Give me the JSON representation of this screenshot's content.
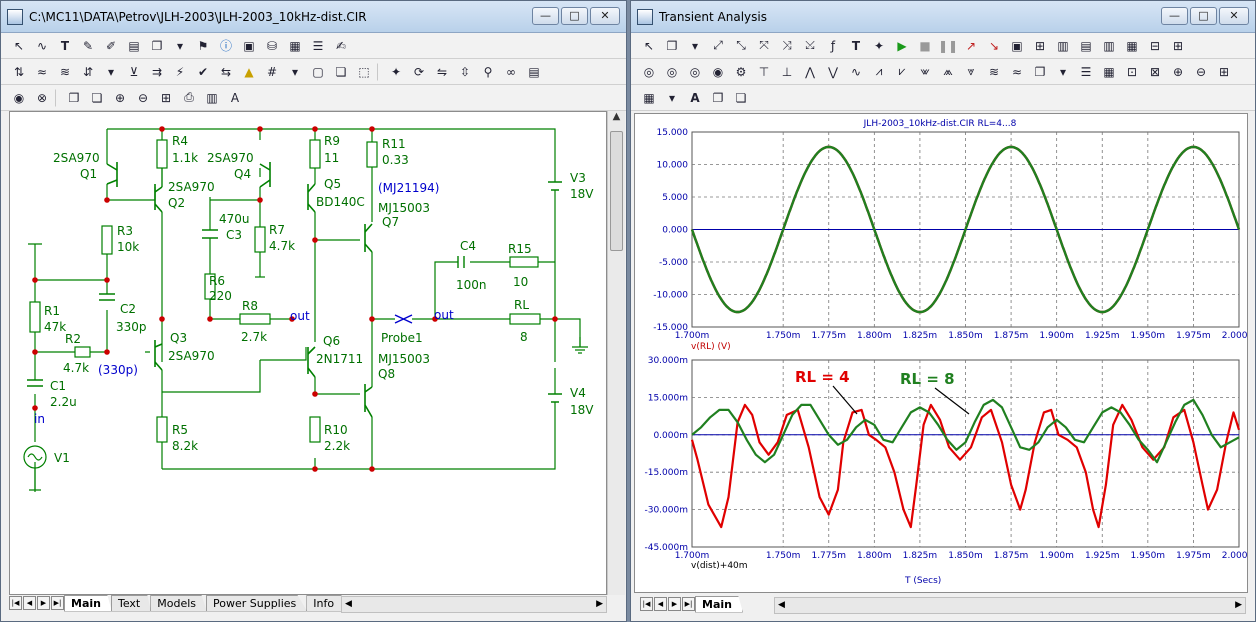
{
  "left_window": {
    "title": "C:\\MC11\\DATA\\Petrov\\JLH-2003\\JLH-2003_10kHz-dist.CIR",
    "controls": [
      "—",
      "□",
      "✕"
    ],
    "tabs": [
      "Main",
      "Text",
      "Models",
      "Power Supplies",
      "Info"
    ],
    "active_tab": "Main"
  },
  "schematic": {
    "labels": {
      "q1_type": "2SA970",
      "q1": "Q1",
      "q2_type": "2SA970",
      "q2": "Q2",
      "r4": "R4",
      "r4v": "1.1k",
      "q4_type": "2SA970",
      "q4": "Q4",
      "r9": "R9",
      "r9v": "11",
      "r11": "R11",
      "r11v": "0.33",
      "q5": "Q5",
      "q5_type": "BD140C",
      "mj21194": "(MJ21194)",
      "mj15003a": "MJ15003",
      "q7": "Q7",
      "v3": "V3",
      "v3v": "18V",
      "r3": "R3",
      "r3v": "10k",
      "c3v": "470u",
      "c3": "C3",
      "r7": "R7",
      "r7v": "4.7k",
      "c4": "C4",
      "r15": "R15",
      "c4v": "100n",
      "r15v": "10",
      "r1": "R1",
      "r1v": "47k",
      "c2": "C2",
      "c2v": "330p",
      "r6": "R6",
      "r6v": "220",
      "r8": "R8",
      "r8v": "2.7k",
      "out1": "out",
      "rl": "RL",
      "rlv": "8",
      "probe": "Probe1",
      "out2": "out",
      "r2": "R2",
      "r2v": "4.7k",
      "c330": "(330p)",
      "q3": "Q3",
      "q3_type": "2SA970",
      "q6": "Q6",
      "q6_type": "2N1711",
      "mj15003b": "MJ15003",
      "q8": "Q8",
      "c1": "C1",
      "c1v": "2.2u",
      "in": "in",
      "v1": "V1",
      "v4": "V4",
      "v4v": "18V",
      "r5": "R5",
      "r5v": "8.2k",
      "r10": "R10",
      "r10v": "2.2k"
    },
    "colors": {
      "wire": "#008000",
      "node": "#cc0000",
      "probe": "#0000cc",
      "text": "#007000"
    }
  },
  "right_window": {
    "title": "Transient Analysis",
    "controls": [
      "—",
      "□",
      "✕"
    ],
    "tabs": [
      "Main"
    ],
    "active_tab": "Main"
  },
  "chart_data": [
    {
      "type": "line",
      "title": "JLH-2003_10kHz-dist.CIR RL=4...8",
      "xlabel": "",
      "ylabel": "v(RL) (V)",
      "xlim": [
        1.7,
        2.0
      ],
      "ylim": [
        -15,
        15
      ],
      "x_ticks": [
        "1.700m",
        "1.750m",
        "1.775m",
        "1.800m",
        "1.825m",
        "1.850m",
        "1.875m",
        "1.900m",
        "1.925m",
        "1.950m",
        "1.975m",
        "2.000m"
      ],
      "y_ticks": [
        "15.000",
        "10.000",
        "5.000",
        "0.000",
        "-5.000",
        "-10.000",
        "-15.000"
      ],
      "series": [
        {
          "color": "#d00000",
          "amplitude": 12.7,
          "frequency_khz": 10,
          "peak_at_ms": 1.775
        },
        {
          "color": "#208020",
          "amplitude": 12.7,
          "frequency_khz": 10,
          "peak_at_ms": 1.775
        }
      ],
      "units": "ms"
    },
    {
      "type": "line",
      "title": "",
      "xlabel": "T (Secs)",
      "ylabel": "v(dist)+40m",
      "xlim": [
        1.7,
        2.0
      ],
      "ylim": [
        -45,
        30
      ],
      "y_units": "mV",
      "x_ticks": [
        "1.700m",
        "1.750m",
        "1.775m",
        "1.800m",
        "1.825m",
        "1.850m",
        "1.875m",
        "1.900m",
        "1.925m",
        "1.950m",
        "1.975m",
        "2.000m"
      ],
      "y_ticks": [
        "30.000m",
        "15.000m",
        "0.000m",
        "-15.000m",
        "-30.000m",
        "-45.000m"
      ],
      "series": [
        {
          "name": "RL = 4",
          "color": "#e00000",
          "x": [
            1.7,
            1.703,
            1.709,
            1.716,
            1.72,
            1.725,
            1.729,
            1.733,
            1.737,
            1.742,
            1.747,
            1.752,
            1.758,
            1.764,
            1.77,
            1.775,
            1.78,
            1.783,
            1.788,
            1.793,
            1.797,
            1.801,
            1.806,
            1.811,
            1.816,
            1.82,
            1.823,
            1.827,
            1.831,
            1.836,
            1.841,
            1.847,
            1.853,
            1.859,
            1.864,
            1.87,
            1.875,
            1.88,
            1.883,
            1.888,
            1.893,
            1.897,
            1.901,
            1.906,
            1.911,
            1.916,
            1.92,
            1.923,
            1.927,
            1.931,
            1.936,
            1.941,
            1.947,
            1.953,
            1.959,
            1.964,
            1.97,
            1.975,
            1.98,
            1.983,
            1.988,
            1.993,
            1.997,
            2.0
          ],
          "y": [
            -2,
            -10,
            -28,
            -37,
            -25,
            5,
            12,
            8,
            -3,
            -8,
            -3,
            8,
            10,
            -5,
            -25,
            -32,
            -22,
            -3,
            9,
            10,
            0,
            -2,
            -5,
            -15,
            -30,
            -37,
            -20,
            4,
            12,
            6,
            -5,
            -10,
            -5,
            7,
            10,
            -3,
            -20,
            -30,
            -22,
            -3,
            9,
            10,
            0,
            -2,
            -5,
            -15,
            -30,
            -37,
            -20,
            4,
            12,
            6,
            -5,
            -10,
            -5,
            7,
            10,
            -3,
            -20,
            -30,
            -22,
            -3,
            9,
            2
          ]
        },
        {
          "name": "RL = 8",
          "color": "#208020",
          "x": [
            1.7,
            1.705,
            1.71,
            1.715,
            1.72,
            1.725,
            1.73,
            1.735,
            1.74,
            1.745,
            1.75,
            1.755,
            1.76,
            1.765,
            1.77,
            1.775,
            1.78,
            1.785,
            1.79,
            1.795,
            1.8,
            1.805,
            1.81,
            1.815,
            1.82,
            1.825,
            1.83,
            1.835,
            1.84,
            1.845,
            1.85,
            1.855,
            1.86,
            1.865,
            1.87,
            1.875,
            1.88,
            1.885,
            1.89,
            1.895,
            1.9,
            1.905,
            1.91,
            1.915,
            1.92,
            1.925,
            1.93,
            1.935,
            1.94,
            1.945,
            1.95,
            1.955,
            1.96,
            1.965,
            1.97,
            1.975,
            1.98,
            1.985,
            1.99,
            1.995,
            2.0
          ],
          "y": [
            0,
            3,
            7,
            10,
            10,
            5,
            -2,
            -8,
            -11,
            -8,
            0,
            8,
            12,
            12,
            6,
            0,
            -4,
            -2,
            3,
            6,
            4,
            -2,
            -3,
            3,
            9,
            11,
            9,
            4,
            -2,
            -6,
            -3,
            5,
            12,
            14,
            11,
            3,
            -5,
            -6,
            -3,
            3,
            6,
            3,
            -2,
            -3,
            3,
            9,
            11,
            9,
            4,
            -2,
            -6,
            -11,
            -3,
            5,
            12,
            14,
            8,
            0,
            -5,
            -3,
            -1
          ]
        }
      ],
      "annotations": [
        {
          "text": "RL = 4",
          "color": "#e00000"
        },
        {
          "text": "RL = 8",
          "color": "#208020"
        }
      ],
      "units": "ms"
    }
  ]
}
